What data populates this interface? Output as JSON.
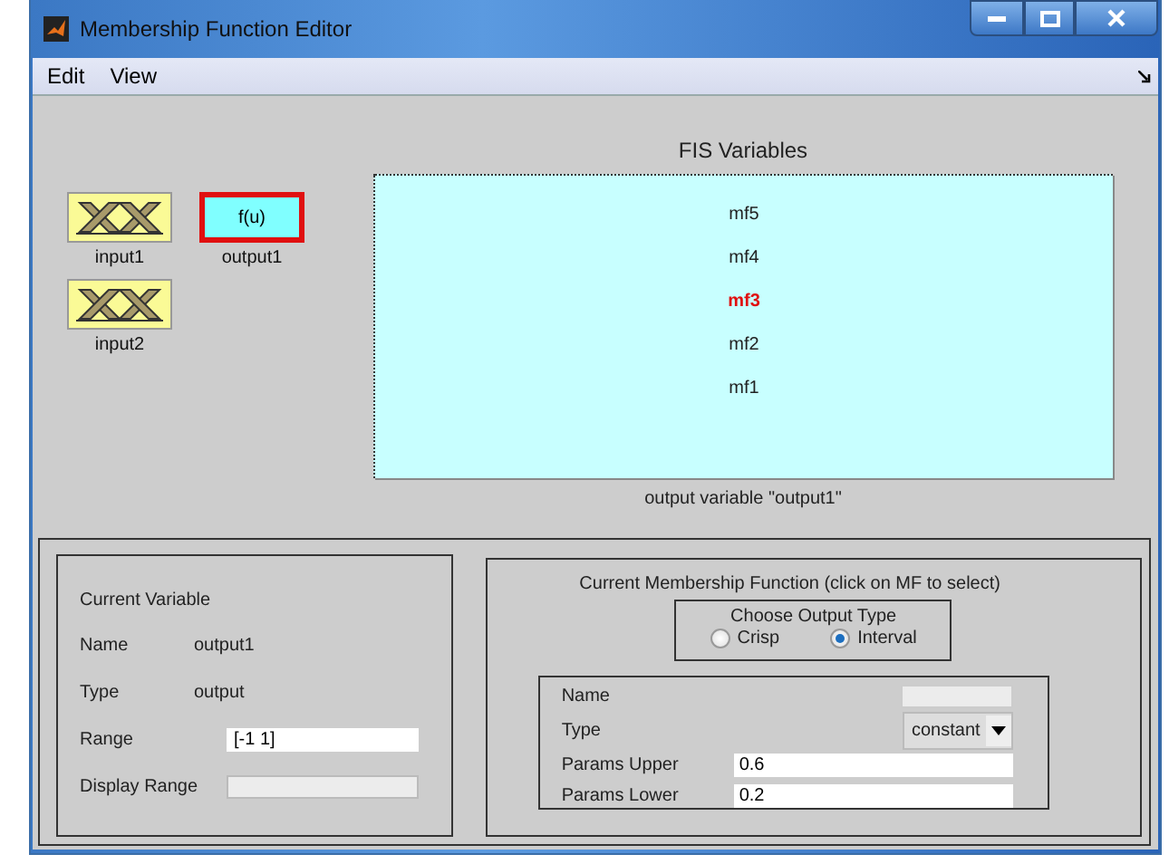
{
  "window": {
    "title": "Membership Function Editor"
  },
  "menu": [
    "Edit",
    "View"
  ],
  "variables": [
    {
      "kind": "input",
      "label": "input1",
      "selected": false
    },
    {
      "kind": "output",
      "label": "output1",
      "symbol": "f(u)",
      "selected": true
    },
    {
      "kind": "input",
      "label": "input2",
      "selected": false
    }
  ],
  "fis": {
    "title": "FIS Variables",
    "caption": "output variable \"output1\"",
    "mfs": [
      {
        "label": "mf5",
        "selected": false
      },
      {
        "label": "mf4",
        "selected": false
      },
      {
        "label": "mf3",
        "selected": true
      },
      {
        "label": "mf2",
        "selected": false
      },
      {
        "label": "mf1",
        "selected": false
      }
    ]
  },
  "current_variable": {
    "title": "Current Variable",
    "fields": [
      {
        "kind": "text",
        "label": "Name",
        "value": "output1"
      },
      {
        "kind": "text",
        "label": "Type",
        "value": "output"
      },
      {
        "kind": "input",
        "label": "Range",
        "value": "[-1 1]",
        "disabled": false
      },
      {
        "kind": "input",
        "label": "Display Range",
        "disabled": true
      }
    ]
  },
  "current_mf": {
    "title": "Current Membership Function (click on MF to select)",
    "output_type": {
      "title": "Choose Output Type",
      "options": [
        {
          "label": "Crisp",
          "selected": false
        },
        {
          "label": "Interval",
          "selected": true
        }
      ]
    },
    "fields": [
      {
        "kind": "input",
        "label": "Name",
        "disabled": true
      },
      {
        "kind": "select",
        "label": "Type",
        "value": "constant"
      },
      {
        "kind": "wide_input",
        "label": "Params Upper",
        "value": "0.6"
      },
      {
        "kind": "wide_input",
        "label": "Params Lower",
        "value": "0.2"
      }
    ]
  }
}
